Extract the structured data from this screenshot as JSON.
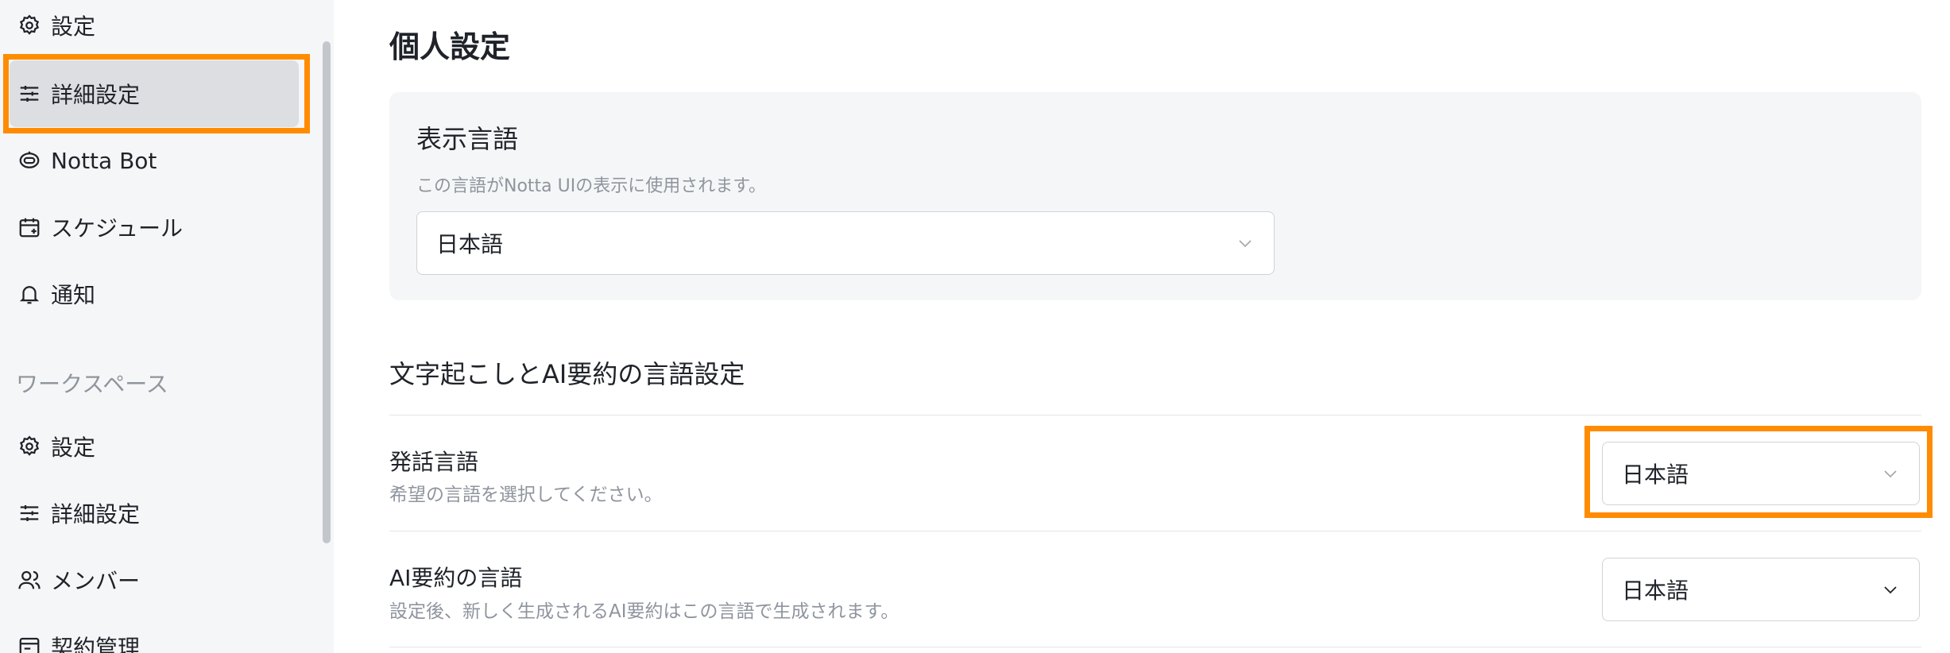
{
  "sidebar": {
    "items": [
      {
        "label": "設定",
        "icon": "gear-icon"
      },
      {
        "label": "詳細設定",
        "icon": "sliders-icon"
      },
      {
        "label": "Notta Bot",
        "icon": "bot-icon"
      },
      {
        "label": "スケジュール",
        "icon": "calendar-icon"
      },
      {
        "label": "通知",
        "icon": "bell-icon"
      }
    ],
    "section_label": "ワークスペース",
    "workspace_items": [
      {
        "label": "設定",
        "icon": "gear-icon"
      },
      {
        "label": "詳細設定",
        "icon": "sliders-icon"
      },
      {
        "label": "メンバー",
        "icon": "users-icon"
      },
      {
        "label": "契約管理",
        "icon": "billing-icon"
      }
    ]
  },
  "main": {
    "page_title": "個人設定",
    "display_language": {
      "title": "表示言語",
      "description": "この言語がNotta UIの表示に使用されます。",
      "value": "日本語"
    },
    "section_title": "文字起こしとAI要約の言語設定",
    "rows": [
      {
        "label": "発話言語",
        "description": "希望の言語を選択してください。",
        "value": "日本語"
      },
      {
        "label": "AI要約の言語",
        "description": "設定後、新しく生成されるAI要約はこの言語で生成されます。",
        "value": "日本語"
      }
    ]
  },
  "colors": {
    "highlight": "#ff8c00",
    "sidebar_bg": "#f5f6f7",
    "active_item_bg": "#dcdee2"
  }
}
